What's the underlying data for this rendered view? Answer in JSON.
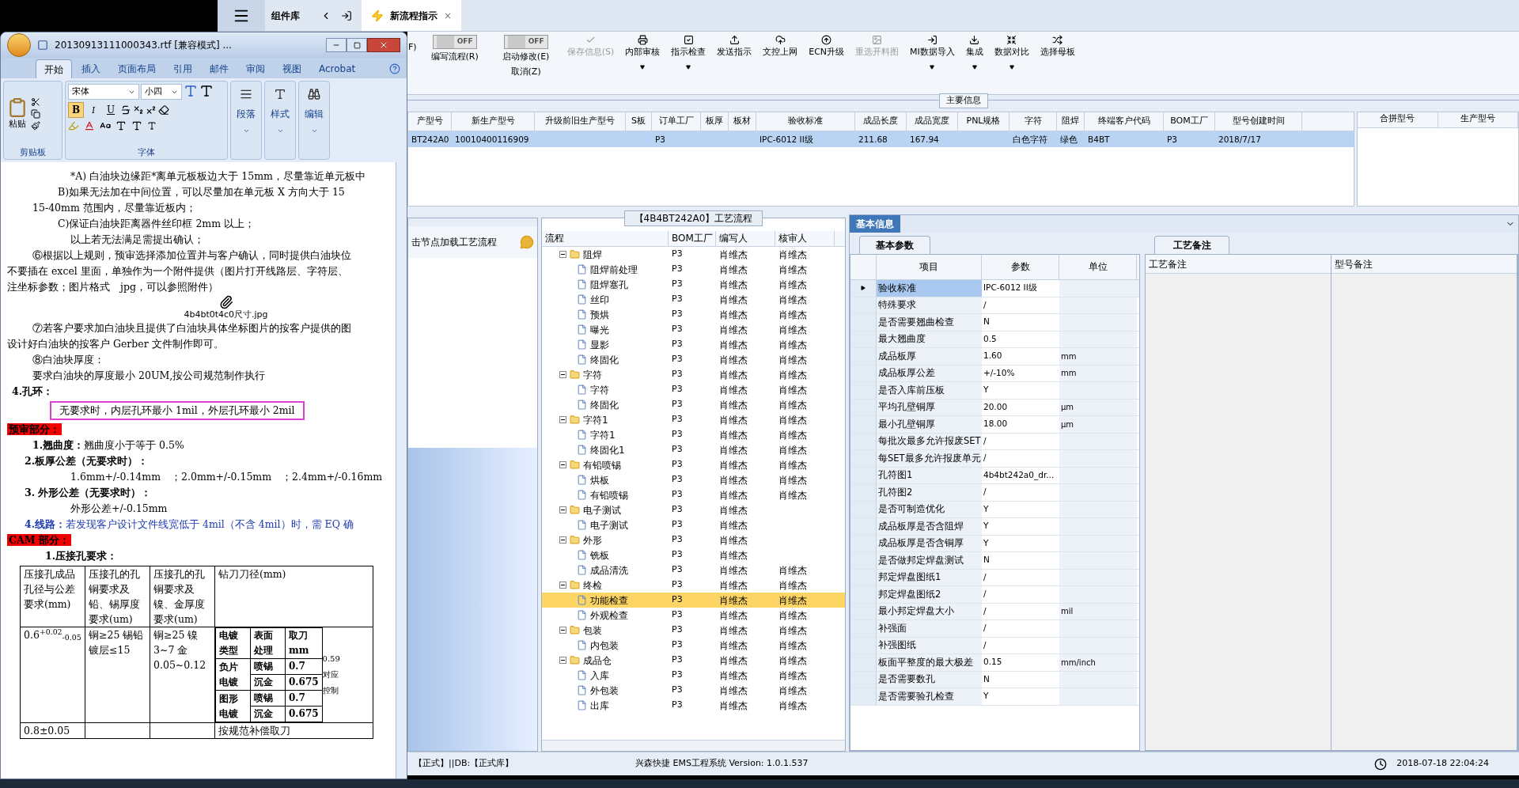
{
  "word": {
    "title": "20130913111000343.rtf [兼容模式] ...",
    "ribbon_tabs": [
      {
        "label": "开始",
        "selected": true
      },
      {
        "label": "插入",
        "selected": false
      },
      {
        "label": "页面布局",
        "selected": false
      },
      {
        "label": "引用",
        "selected": false
      },
      {
        "label": "邮件",
        "selected": false
      },
      {
        "label": "审阅",
        "selected": false
      },
      {
        "label": "视图",
        "selected": false
      },
      {
        "label": "Acrobat",
        "selected": false
      }
    ],
    "clipboard": {
      "paste": "粘贴",
      "group": "剪贴板"
    },
    "font": {
      "family": "宋体",
      "size": "小四",
      "group": "字体",
      "styles": [
        {
          "label": "B",
          "on": true
        },
        {
          "label": "I",
          "on": false
        },
        {
          "label": "U",
          "on": false
        }
      ]
    },
    "groups": [
      "段落",
      "样式",
      "编辑"
    ],
    "document": [
      {
        "kind": "indent3",
        "text": "*A) 白油块边缘距*离单元板板边大于 15mm，尽量靠近单元板中"
      },
      {
        "kind": "indent2",
        "text": "B)如果无法加在中间位置，可以尽量加在单元板 X 方向大于 15"
      },
      {
        "kind": "indent1",
        "text": "15-40mm 范围内，尽量靠近板内；"
      },
      {
        "kind": "indent2",
        "text": "C)保证白油块距离器件丝印框 2mm 以上；"
      },
      {
        "kind": "indent3",
        "text": "以上若无法满足需提出确认；"
      },
      {
        "kind": "indent1",
        "text": "⑥根据以上规则，预审选择添加位置并与客户确认，同时提供白油块位"
      },
      {
        "kind": "plain",
        "text": "不要插在 excel 里面，单独作为一个附件提供（图片打开线路层、字符层、"
      },
      {
        "kind": "plain",
        "text": "注坐标参数；图片格式　jpg，可以参照附件）"
      },
      {
        "kind": "attachment",
        "text": "4b4bt0t4c0尺寸.jpg"
      },
      {
        "kind": "indent1",
        "text": "⑦若客户要求加白油块且提供了白油块具体坐标图片的按客户提供的图"
      },
      {
        "kind": "plain",
        "text": "设计好白油块的按客户 Gerber 文件制作即可。"
      },
      {
        "kind": "indent1",
        "text": "⑧白油块厚度："
      },
      {
        "kind": "indent1",
        "text": "要求白油块的厚度最小 20UM,按公司规范制作执行"
      },
      {
        "kind": "heading",
        "text": "4.孔环："
      },
      {
        "kind": "boxed",
        "text": "无要求时，内层孔环最小 1mil，外层孔环最小 2mil"
      },
      {
        "kind": "red",
        "text": "预审部分："
      },
      {
        "kind": "indent1",
        "text": "**1.翘曲度：**翘曲度小于等于 0.5%"
      },
      {
        "kind": "heading2",
        "text": "2.板厚公差（无要求时）："
      },
      {
        "kind": "indent3",
        "text": "1.6mm+/-0.14mm　；2.0mm+/-0.15mm　；2.4mm+/-0.16mm"
      },
      {
        "kind": "heading2",
        "text": "3. 外形公差（无要求时）："
      },
      {
        "kind": "indent3",
        "text": "外形公差+/-0.15mm"
      },
      {
        "kind": "blue",
        "text": "**4.线路：**若发现客户设计文件线宽低于 4mil（不含 4mil）时，需 EQ 确"
      },
      {
        "kind": "red",
        "text": "CAM 部分："
      },
      {
        "kind": "heading3",
        "text": "1.压接孔要求："
      }
    ],
    "table": {
      "headers": [
        "压接孔成品孔径与公差要求(mm)",
        "压接孔的孔铜要求及铅、锡厚度要求(um)",
        "压接孔的孔铜要求及镍、金厚度要求(um)",
        "钻刀刀径(mm)"
      ],
      "row": [
        "0.6$^{+0.02}$$_{-0.05}$",
        "铜≥25 锡铅镀层≤15",
        "铜≥25 镍3~7 金0.05~0.12"
      ],
      "inner_headers": [
        "电镀类型",
        "表面处理",
        "取刀mm"
      ],
      "inner_rows": [
        {
          "type": "负片电镀",
          "items": [
            [
              "喷锡",
              "0.7"
            ],
            [
              "沉金",
              "0.675"
            ]
          ]
        },
        {
          "type": "图形电镀",
          "items": [
            [
              "喷锡",
              "0.7"
            ],
            [
              "沉金",
              "0.675"
            ]
          ]
        }
      ],
      "side_notes": [
        "0.59",
        "对应",
        "控制"
      ],
      "last_row": [
        "0.8±0.05",
        "按规范补偿取刀"
      ]
    }
  },
  "app": {
    "panel_label": "组件库",
    "tabs": [
      {
        "label": "新流程指示",
        "selected": true,
        "close": "×"
      }
    ],
    "toolbar_cut": "F)",
    "toolbar": [
      {
        "kind": "toggle",
        "switch_text": "OFF",
        "on": false,
        "label": "编写流程(R)"
      },
      {
        "kind": "toggle",
        "switch_text": "OFF",
        "on": false,
        "label": "启动修改(E)",
        "sublabel": "取消(Z)"
      },
      {
        "kind": "button",
        "label": "保存信息(S)",
        "disabled": true,
        "dropdown": false
      },
      {
        "kind": "button",
        "label": "内部审核",
        "disabled": false,
        "dropdown": true
      },
      {
        "kind": "button",
        "label": "指示检查",
        "disabled": false,
        "dropdown": true
      },
      {
        "kind": "button",
        "label": "发送指示",
        "disabled": false,
        "dropdown": false
      },
      {
        "kind": "button",
        "label": "文控上网",
        "disabled": false,
        "dropdown": false
      },
      {
        "kind": "button",
        "label": "ECN升级",
        "disabled": false,
        "dropdown": false
      },
      {
        "kind": "button",
        "label": "重选开料图",
        "disabled": true,
        "dropdown": false
      },
      {
        "kind": "button",
        "label": "MI数据导入",
        "disabled": false,
        "dropdown": true
      },
      {
        "kind": "button",
        "label": "集成",
        "disabled": false,
        "dropdown": true
      },
      {
        "kind": "button",
        "label": "数据对比",
        "disabled": false,
        "dropdown": true
      },
      {
        "kind": "button",
        "label": "选择母板",
        "disabled": false,
        "dropdown": false
      }
    ],
    "main_info": {
      "legend": "主要信息",
      "columns": [
        "产型号",
        "新生产型号",
        "升级前旧生产型号",
        "S板",
        "订单工厂",
        "板厚",
        "板材",
        "验收标准",
        "成品长度",
        "成品宽度",
        "PNL规格",
        "字符",
        "阻焊",
        "终端客户代码",
        "BOM工厂",
        "型号创建时间"
      ],
      "rows": [
        {
          "selected": true,
          "cells": [
            "BT242A0",
            "10010400116909",
            "",
            "",
            "P3",
            "",
            "",
            "IPC-6012 II级",
            "211.68",
            "167.94",
            "",
            "白色字符",
            "绿色",
            "B4BT",
            "P3",
            "2018/7/17"
          ]
        }
      ],
      "side_columns": [
        "合拼型号",
        "生产型号"
      ]
    },
    "node_hint": "击节点加载工艺流程",
    "flow": {
      "title": "【4B4BT242A0】工艺流程",
      "columns": [
        "流程",
        "BOM工厂",
        "编写人",
        "核审人"
      ],
      "nodes": [
        {
          "name": "阻焊",
          "bom": "P3",
          "writer": "肖维杰",
          "reviewer": "肖维杰",
          "expanded": true,
          "selected": false,
          "children": [
            {
              "name": "阻焊前处理",
              "bom": "P3",
              "writer": "肖维杰",
              "reviewer": "肖维杰",
              "selected": false
            },
            {
              "name": "阻焊塞孔",
              "bom": "P3",
              "writer": "肖维杰",
              "reviewer": "肖维杰",
              "selected": false
            },
            {
              "name": "丝印",
              "bom": "P3",
              "writer": "肖维杰",
              "reviewer": "肖维杰",
              "selected": false
            },
            {
              "name": "预烘",
              "bom": "P3",
              "writer": "肖维杰",
              "reviewer": "肖维杰",
              "selected": false
            },
            {
              "name": "曝光",
              "bom": "P3",
              "writer": "肖维杰",
              "reviewer": "肖维杰",
              "selected": false
            },
            {
              "name": "显影",
              "bom": "P3",
              "writer": "肖维杰",
              "reviewer": "肖维杰",
              "selected": false
            },
            {
              "name": "终固化",
              "bom": "P3",
              "writer": "肖维杰",
              "reviewer": "肖维杰",
              "selected": false
            }
          ]
        },
        {
          "name": "字符",
          "bom": "P3",
          "writer": "肖维杰",
          "reviewer": "肖维杰",
          "expanded": true,
          "selected": false,
          "children": [
            {
              "name": "字符",
              "bom": "P3",
              "writer": "肖维杰",
              "reviewer": "肖维杰",
              "selected": false
            },
            {
              "name": "终固化",
              "bom": "P3",
              "writer": "肖维杰",
              "reviewer": "肖维杰",
              "selected": false
            }
          ]
        },
        {
          "name": "字符1",
          "bom": "P3",
          "writer": "肖维杰",
          "reviewer": "肖维杰",
          "expanded": true,
          "selected": false,
          "children": [
            {
              "name": "字符1",
              "bom": "P3",
              "writer": "肖维杰",
              "reviewer": "肖维杰",
              "selected": false
            },
            {
              "name": "终固化1",
              "bom": "P3",
              "writer": "肖维杰",
              "reviewer": "肖维杰",
              "selected": false
            }
          ]
        },
        {
          "name": "有铅喷锡",
          "bom": "P3",
          "writer": "肖维杰",
          "reviewer": "肖维杰",
          "expanded": true,
          "selected": false,
          "children": [
            {
              "name": "烘板",
              "bom": "P3",
              "writer": "肖维杰",
              "reviewer": "肖维杰",
              "selected": false
            },
            {
              "name": "有铅喷锡",
              "bom": "P3",
              "writer": "肖维杰",
              "reviewer": "肖维杰",
              "selected": false
            }
          ]
        },
        {
          "name": "电子测试",
          "bom": "P3",
          "writer": "肖维杰",
          "expanded": true,
          "selected": false,
          "children": [
            {
              "name": "电子测试",
              "bom": "P3",
              "writer": "肖维杰",
              "selected": false
            }
          ]
        },
        {
          "name": "外形",
          "bom": "P3",
          "writer": "肖维杰",
          "expanded": true,
          "selected": false,
          "children": [
            {
              "name": "铣板",
              "bom": "P3",
              "writer": "肖维杰",
              "selected": false
            },
            {
              "name": "成品清洗",
              "bom": "P3",
              "writer": "肖维杰",
              "reviewer": "肖维杰",
              "selected": false
            }
          ]
        },
        {
          "name": "终检",
          "bom": "P3",
          "writer": "肖维杰",
          "reviewer": "肖维杰",
          "expanded": true,
          "selected": false,
          "children": [
            {
              "name": "功能检查",
              "bom": "P3",
              "writer": "肖维杰",
              "reviewer": "肖维杰",
              "selected": true
            },
            {
              "name": "外观检查",
              "bom": "P3",
              "writer": "肖维杰",
              "reviewer": "肖维杰",
              "selected": false
            }
          ]
        },
        {
          "name": "包装",
          "bom": "P3",
          "writer": "肖维杰",
          "reviewer": "肖维杰",
          "expanded": true,
          "selected": false,
          "children": [
            {
              "name": "内包装",
              "bom": "P3",
              "writer": "肖维杰",
              "reviewer": "肖维杰",
              "selected": false
            }
          ]
        },
        {
          "name": "成品仓",
          "bom": "P3",
          "writer": "肖维杰",
          "reviewer": "肖维杰",
          "expanded": true,
          "selected": false,
          "children": [
            {
              "name": "入库",
              "bom": "P3",
              "writer": "肖维杰",
              "reviewer": "肖维杰",
              "selected": false
            },
            {
              "name": "外包装",
              "bom": "P3",
              "writer": "肖维杰",
              "reviewer": "肖维杰",
              "selected": false
            },
            {
              "name": "出库",
              "bom": "P3",
              "writer": "肖维杰",
              "reviewer": "肖维杰",
              "selected": false
            }
          ]
        }
      ]
    },
    "basic": {
      "title": "基本信息",
      "tab": "基本参数",
      "columns": [
        "项目",
        "参数",
        "单位"
      ],
      "rows": [
        {
          "item": "验收标准",
          "value": "IPC-6012 II级",
          "unit": "",
          "selected": true
        },
        {
          "item": "特殊要求",
          "value": "/",
          "unit": "",
          "selected": false
        },
        {
          "item": "是否需要翘曲检查",
          "value": "N",
          "unit": "",
          "selected": false
        },
        {
          "item": "最大翘曲度",
          "value": "0.5",
          "unit": "",
          "selected": false
        },
        {
          "item": "成品板厚",
          "value": "1.60",
          "unit": "mm",
          "selected": false
        },
        {
          "item": "成品板厚公差",
          "value": "+/-10%",
          "unit": "mm",
          "selected": false
        },
        {
          "item": "是否入库前压板",
          "value": "Y",
          "unit": "",
          "selected": false
        },
        {
          "item": "平均孔壁铜厚",
          "value": "20.00",
          "unit": "μm",
          "selected": false
        },
        {
          "item": "最小孔壁铜厚",
          "value": "18.00",
          "unit": "μm",
          "selected": false
        },
        {
          "item": "每批次最多允许报废SET",
          "value": "/",
          "unit": "",
          "selected": false
        },
        {
          "item": "每SET最多允许报废单元",
          "value": "/",
          "unit": "",
          "selected": false
        },
        {
          "item": "孔符图1",
          "value": "4b4bt242a0_dr...",
          "unit": "",
          "selected": false
        },
        {
          "item": "孔符图2",
          "value": "/",
          "unit": "",
          "selected": false
        },
        {
          "item": "是否可制造优化",
          "value": "Y",
          "unit": "",
          "selected": false
        },
        {
          "item": "成品板厚是否含阻焊",
          "value": "Y",
          "unit": "",
          "selected": false
        },
        {
          "item": "成品板厚是否含铜厚",
          "value": "Y",
          "unit": "",
          "selected": false
        },
        {
          "item": "是否做邦定焊盘测试",
          "value": "N",
          "unit": "",
          "selected": false
        },
        {
          "item": "邦定焊盘图纸1",
          "value": "/",
          "unit": "",
          "selected": false
        },
        {
          "item": "邦定焊盘图纸2",
          "value": "/",
          "unit": "",
          "selected": false
        },
        {
          "item": "最小邦定焊盘大小",
          "value": "/",
          "unit": "mil",
          "selected": false
        },
        {
          "item": "补强面",
          "value": "/",
          "unit": "",
          "selected": false
        },
        {
          "item": "补强图纸",
          "value": "/",
          "unit": "",
          "selected": false
        },
        {
          "item": "板面平整度的最大极差",
          "value": "0.15",
          "unit": "mm/inch",
          "selected": false
        },
        {
          "item": "是否需要数孔",
          "value": "N",
          "unit": "",
          "selected": false
        },
        {
          "item": "是否需要验孔检查",
          "value": "Y",
          "unit": "",
          "selected": false
        }
      ]
    },
    "notes": {
      "tab": "工艺备注",
      "columns": [
        "工艺备注",
        "型号备注"
      ]
    },
    "status": {
      "env": "【正式】||DB:【正式库】",
      "system": "兴森快捷 EMS工程系统 Version: 1.0.1.537",
      "time": "2018-07-18 22:04:24"
    }
  }
}
